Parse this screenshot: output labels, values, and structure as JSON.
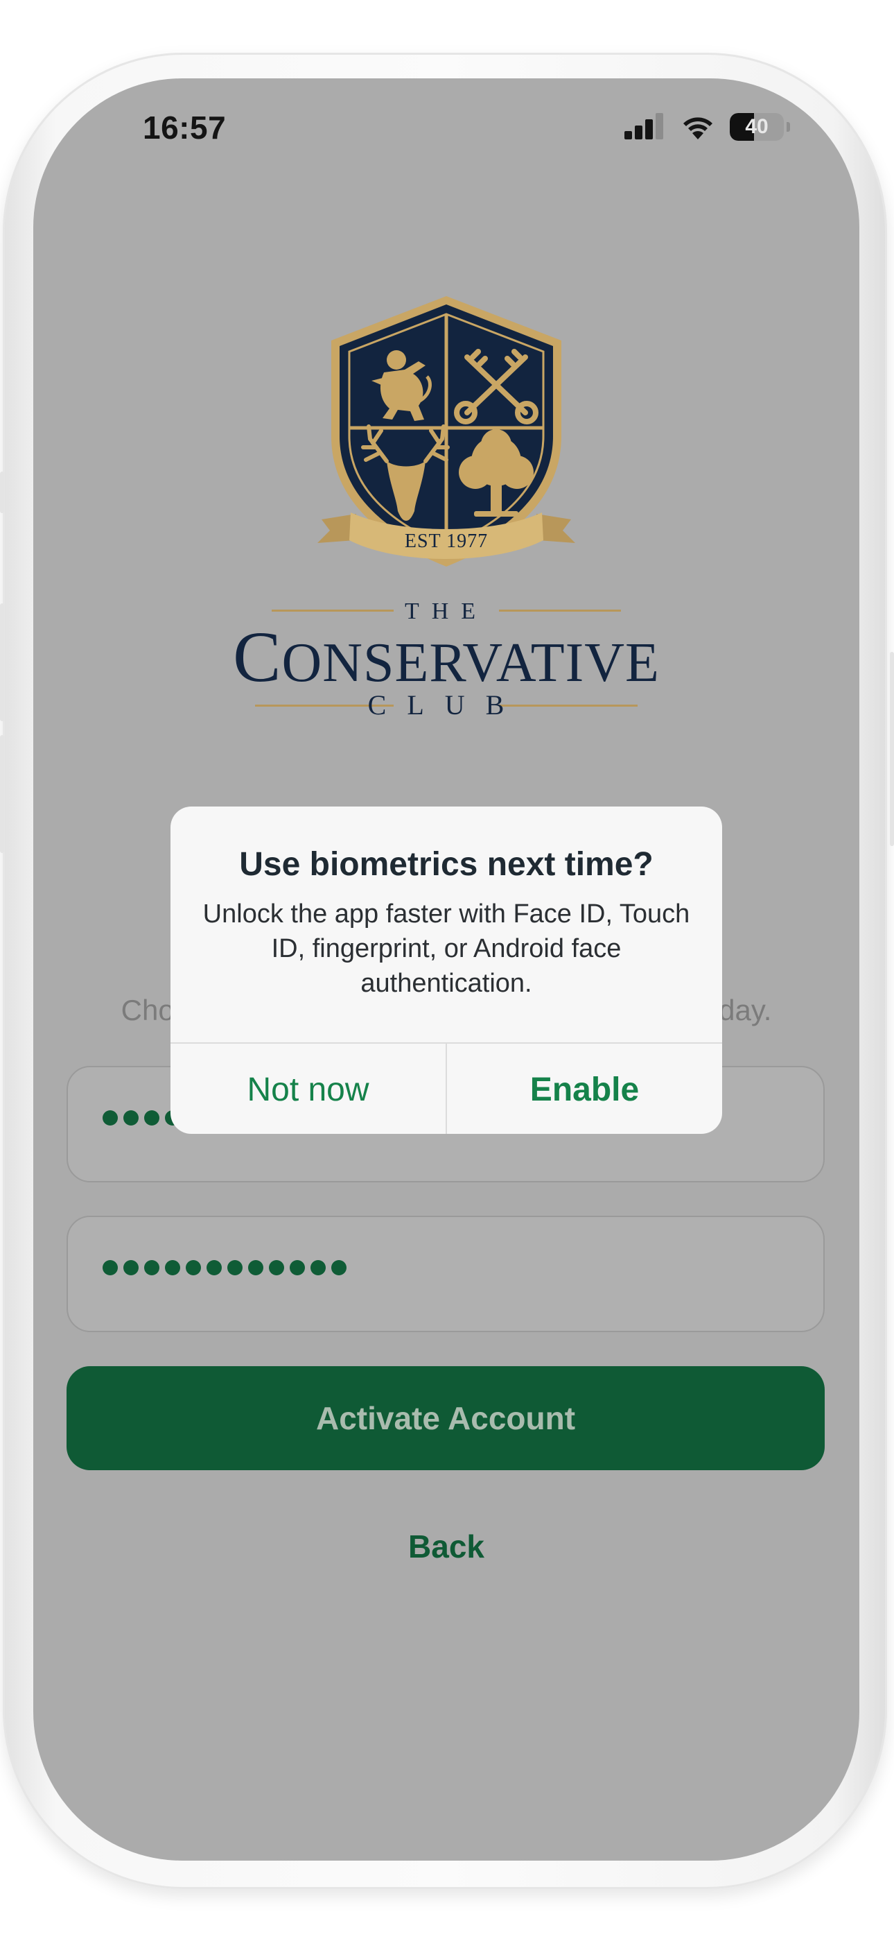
{
  "status_bar": {
    "time": "16:57",
    "battery": "40"
  },
  "logo": {
    "crest_banner": "EST 1977",
    "the": "THE",
    "name_initial": "C",
    "name_rest": "ONSERVATIVE",
    "club": "CLUB"
  },
  "form": {
    "hint_text": "Choose a password you'll use to sign in every day.",
    "password_dots": 12,
    "confirm_dots": 12,
    "activate_label": "Activate Account",
    "back_label": "Back"
  },
  "dialog": {
    "title": "Use biometrics next time?",
    "message": "Unlock the app faster with Face ID, Touch ID, fingerprint, or Android face authentication.",
    "cancel_label": "Not now",
    "confirm_label": "Enable"
  },
  "colors": {
    "overlay_gray": "#ababab",
    "brand_green": "#0f5a35",
    "dialog_green": "#15824a",
    "crest_navy": "#12243f",
    "crest_gold": "#c9a664"
  }
}
